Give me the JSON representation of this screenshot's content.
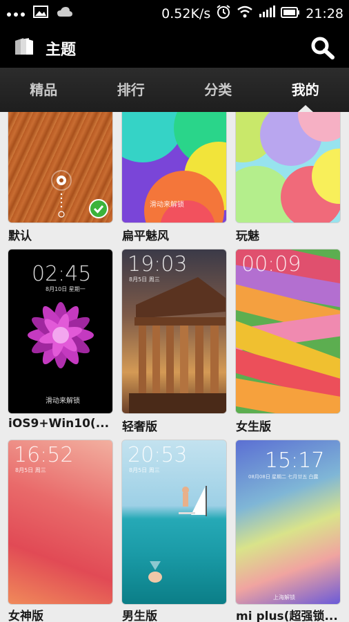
{
  "status_bar": {
    "speed": "0.52K/s",
    "time": "21:28"
  },
  "app_bar": {
    "title": "主题"
  },
  "tabs": [
    {
      "label": "精品"
    },
    {
      "label": "排行"
    },
    {
      "label": "分类"
    },
    {
      "label": "我的"
    }
  ],
  "themes": [
    {
      "name": "默认"
    },
    {
      "name": "扁平魅风",
      "unlock_hint": "滑动来解锁"
    },
    {
      "name": "玩魅"
    },
    {
      "name": "iOS9+Win10(...",
      "clock": "02:45",
      "date": "8月10日 星期一",
      "unlock_hint": "滑动来解锁"
    },
    {
      "name": "轻奢版",
      "clock": "19:03",
      "date": "8月5日 周三"
    },
    {
      "name": "女生版",
      "clock": "00:09"
    },
    {
      "name": "女神版",
      "clock": "16:52",
      "date": "8月5日 周三"
    },
    {
      "name": "男生版",
      "clock": "20:53",
      "date": "8月5日 周三"
    },
    {
      "name": "mi plus(超强锁...",
      "clock": "15:17",
      "date": "08月08日 星期二 七月廿五 白露",
      "city": "上海解锁"
    }
  ]
}
